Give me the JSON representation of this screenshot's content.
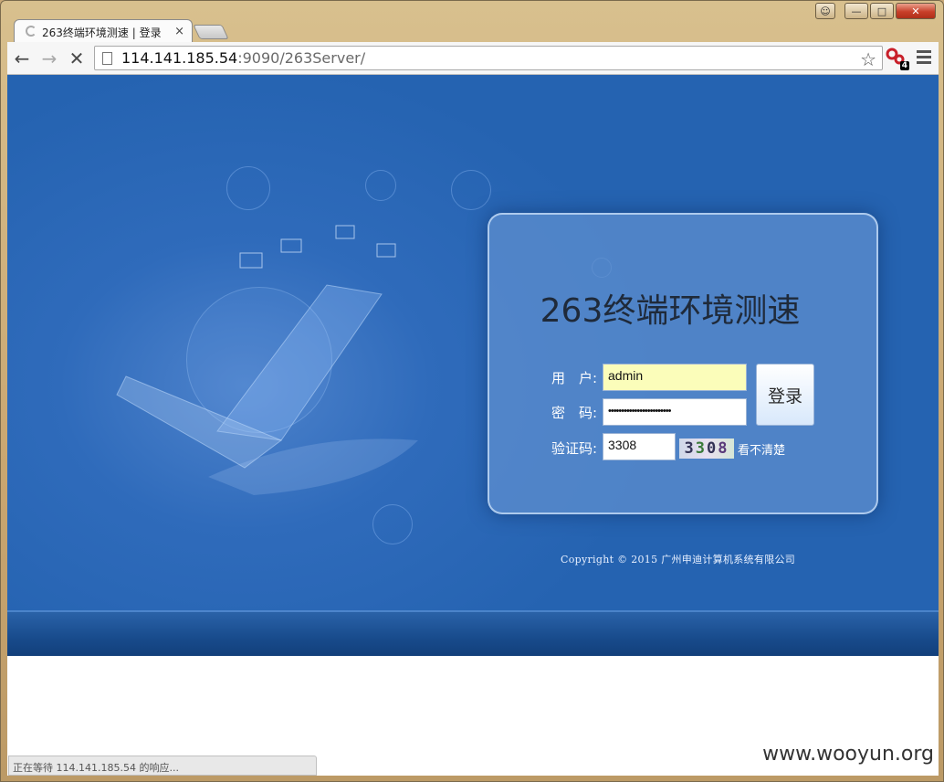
{
  "browser": {
    "tab_title": "263终端环境测速 | 登录",
    "tab_close": "×",
    "url_host": "114.141.185.54",
    "url_path": ":9090/263Server/",
    "extension_badge": "4",
    "status_text": "正在等待 114.141.185.54 的响应..."
  },
  "login": {
    "title": "263终端环境测速",
    "username_label": "用　户:",
    "username_value": "admin",
    "password_label": "密　码:",
    "password_value": "••••••••••••••••••••••••",
    "captcha_label": "验证码:",
    "captcha_input": "3308",
    "captcha_image_text": [
      "3",
      "3",
      "0",
      "8"
    ],
    "refresh_text": "看不清楚",
    "submit_label": "登录"
  },
  "footer": {
    "copyright": "Copyright © 2015 广州申迪计算机系统有限公司"
  },
  "watermark": "www.wooyun.org",
  "colors": {
    "hero_bg": "#2563b1",
    "panel_bg": "#6090d0",
    "username_bg": "#fbfdba"
  }
}
